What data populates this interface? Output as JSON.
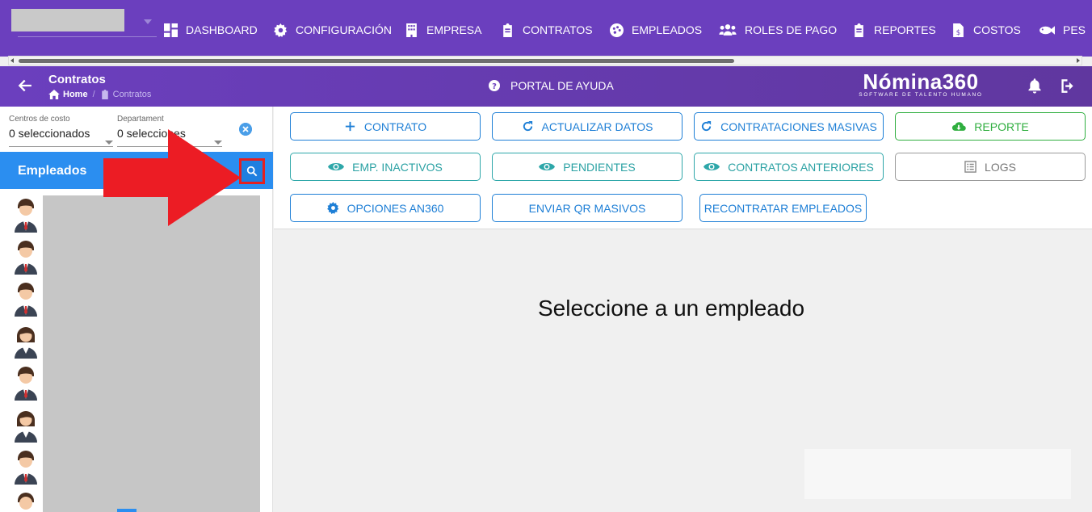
{
  "nav": {
    "items": [
      {
        "label": "DASHBOARD",
        "icon": "dashboard-icon"
      },
      {
        "label": "CONFIGURACIÓN",
        "icon": "gear-icon"
      },
      {
        "label": "EMPRESA",
        "icon": "building-icon"
      },
      {
        "label": "CONTRATOS",
        "icon": "clipboard-icon"
      },
      {
        "label": "EMPLEADOS",
        "icon": "palette-icon"
      },
      {
        "label": "ROLES DE PAGO",
        "icon": "users-icon"
      },
      {
        "label": "REPORTES",
        "icon": "clipboard-icon"
      },
      {
        "label": "COSTOS",
        "icon": "file-dollar-icon"
      },
      {
        "label": "PES",
        "icon": "fish-icon"
      }
    ]
  },
  "header": {
    "title": "Contratos",
    "breadcrumb_home": "Home",
    "breadcrumb_current": "Contratos",
    "help_label": "PORTAL DE AYUDA",
    "logo_name": "Nómina360",
    "logo_tagline": "SOFTWARE DE TALENTO HUMANO"
  },
  "filters": {
    "cost_center_label": "Centros de costo",
    "cost_center_value": "0 seleccionados",
    "department_label": "Departament",
    "department_value": "0 selecciones"
  },
  "employees": {
    "title": "Empleados"
  },
  "actions": {
    "contrato": "CONTRATO",
    "actualizar": "ACTUALIZAR DATOS",
    "masivas": "CONTRATACIONES MASIVAS",
    "reporte": "REPORTE",
    "inactivos": "EMP. INACTIVOS",
    "pendientes": "PENDIENTES",
    "anteriores": "CONTRATOS ANTERIORES",
    "logs": "LOGS",
    "opciones": "OPCIONES AN360",
    "qr": "ENVIAR QR MASIVOS",
    "recontratar": "RECONTRATAR EMPLEADOS"
  },
  "main": {
    "empty_message": "Seleccione a un empleado"
  },
  "colors": {
    "nav_bg": "#6b3fbe",
    "accent_blue": "#1e7fd6",
    "teal": "#2ea7a9",
    "green": "#2fae3f",
    "highlight_red": "#e52020"
  }
}
